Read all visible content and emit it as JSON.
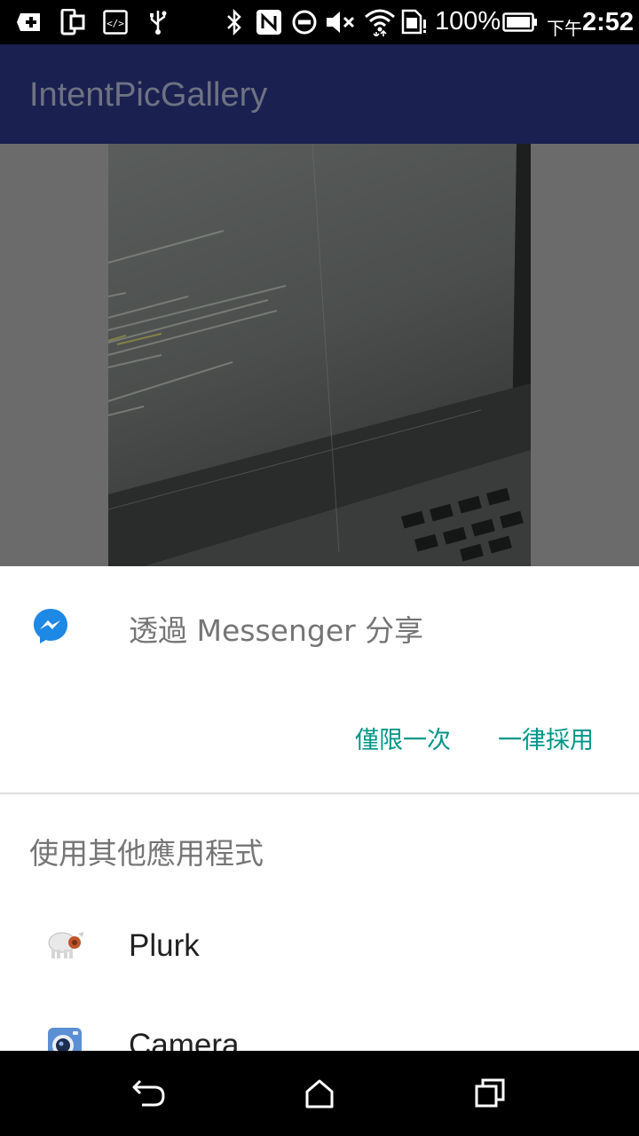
{
  "status_bar": {
    "battery_percent": "100%",
    "time_prefix": "下午",
    "time": "2:52",
    "icons": [
      "add-box-icon",
      "screen-mirror-icon",
      "code-icon",
      "usb-icon",
      "bluetooth-icon",
      "nfc-icon",
      "do-not-disturb-icon",
      "mute-icon",
      "wifi-icon",
      "sim-alert-icon",
      "battery-icon"
    ]
  },
  "app_bar": {
    "title": "IntentPicGallery"
  },
  "chooser": {
    "default_app": {
      "icon": "messenger-icon",
      "label": "透過 Messenger 分享"
    },
    "just_once_label": "僅限一次",
    "always_label": "一律採用",
    "other_apps_title": "使用其他應用程式",
    "apps": [
      {
        "icon": "plurk-icon",
        "name": "Plurk"
      },
      {
        "icon": "camera-icon",
        "name": "Camera"
      }
    ]
  },
  "nav_bar": {
    "icons": [
      "back-icon",
      "home-icon",
      "recents-icon"
    ]
  },
  "colors": {
    "app_bar": "#1a2151",
    "accent": "#009688",
    "scrim": "#6b6b6b"
  }
}
